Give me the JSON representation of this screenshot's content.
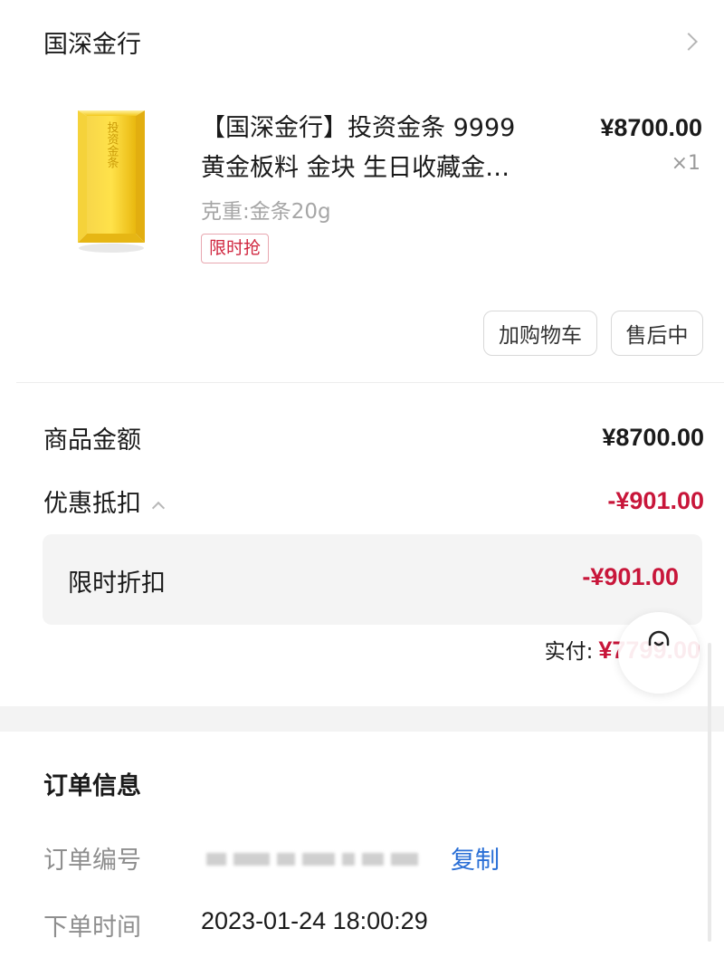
{
  "store": {
    "name": "国深金行"
  },
  "product": {
    "title_line1": "【国深金行】投资金条 9999",
    "title_line2": "黄金板料 金块 生日收藏金…",
    "image_text": "投资金条",
    "price": "¥8700.00",
    "quantity": "×1",
    "spec": "克重:金条20g",
    "tag": "限时抢"
  },
  "actions": {
    "add_to_cart": "加购物车",
    "after_sale": "售后中"
  },
  "summary": {
    "goods_amount_label": "商品金额",
    "goods_amount": "¥8700.00",
    "discount_label": "优惠抵扣",
    "discount_amount": "-¥901.00",
    "flash_discount_label": "限时折扣",
    "flash_discount_amount": "-¥901.00",
    "paid_label": "实付:",
    "paid_amount": "¥7799.00"
  },
  "order_info": {
    "title": "订单信息",
    "order_no_label": "订单编号",
    "copy_label": "复制",
    "order_time_label": "下单时间",
    "order_time": "2023-01-24 18:00:29"
  },
  "colors": {
    "accent_red": "#c8163a",
    "link_blue": "#2a6fd6",
    "gold": "#f2c21a"
  },
  "icons": {
    "store_chevron": "chevron-right-icon",
    "discount_toggle": "chevron-up-icon",
    "float": "headset-icon"
  }
}
